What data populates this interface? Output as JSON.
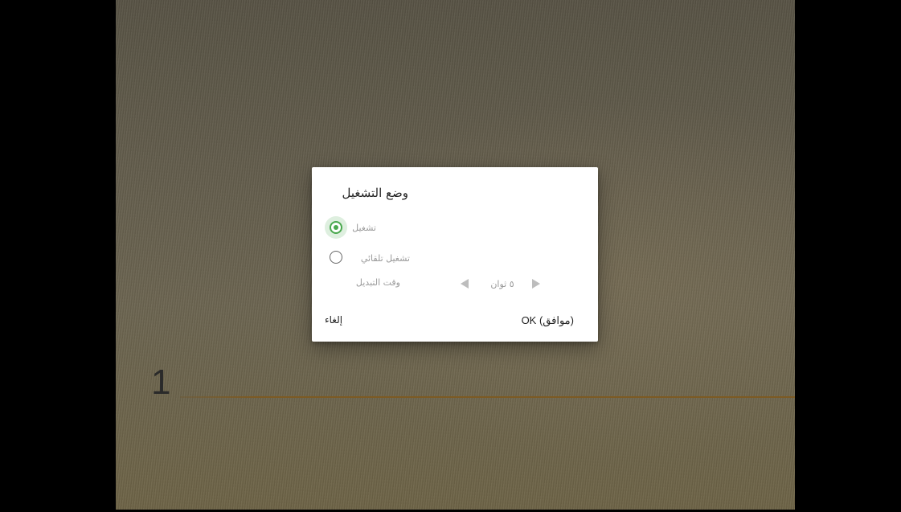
{
  "slide": {
    "number": "1"
  },
  "dialog": {
    "title": "وضع التشغيل",
    "options": [
      {
        "label": "تشغيل",
        "selected": true
      },
      {
        "label": "تشغيل تلقائي",
        "selected": false
      }
    ],
    "interval": {
      "label": "وقت التبديل",
      "value": "٥ ثوان"
    },
    "buttons": {
      "ok": "OK (موافق)",
      "cancel": "إلغاء"
    }
  },
  "colors": {
    "accent": "#4aa84e",
    "slide_rule": "#7c5a23"
  },
  "icons": {
    "prev": "arrow-left-icon",
    "next": "arrow-right-icon"
  }
}
